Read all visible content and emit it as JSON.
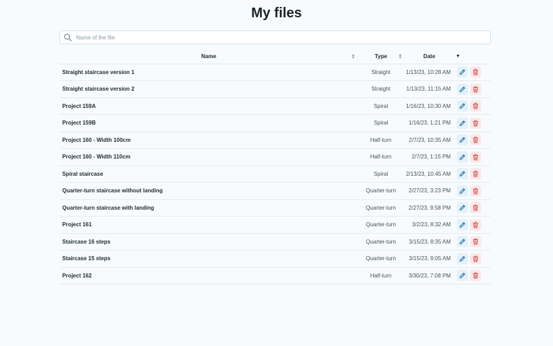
{
  "page": {
    "title": "My files"
  },
  "search": {
    "placeholder": "Name of the file",
    "value": ""
  },
  "columns": {
    "name": "Name",
    "type": "Type",
    "date": "Date"
  },
  "colors": {
    "edit_icon": "#1c6fa0",
    "delete_icon": "#d64545"
  },
  "files": [
    {
      "name": "Straight staircase version 1",
      "type": "Straight",
      "date": "1/13/23, 10:28 AM"
    },
    {
      "name": "Straight staircase version 2",
      "type": "Straight",
      "date": "1/13/23, 11:15 AM"
    },
    {
      "name": "Project 159A",
      "type": "Spiral",
      "date": "1/16/23, 10:30 AM"
    },
    {
      "name": "Project 159B",
      "type": "Spiral",
      "date": "1/16/23, 1:21 PM"
    },
    {
      "name": "Project 160 - Width 100cm",
      "type": "Half-turn",
      "date": "2/7/23, 10:35 AM"
    },
    {
      "name": "Project 160 - Width 110cm",
      "type": "Half-turn",
      "date": "2/7/23, 1:15 PM"
    },
    {
      "name": "Spiral staircase",
      "type": "Spiral",
      "date": "2/13/23, 10:45 AM"
    },
    {
      "name": "Quarter-turn staircase without landing",
      "type": "Quarter-turn",
      "date": "2/27/23, 3:23 PM"
    },
    {
      "name": "Quarter-turn staircase with landing",
      "type": "Quarter-turn",
      "date": "2/27/23, 9:58 PM"
    },
    {
      "name": "Project 161",
      "type": "Quarter-turn",
      "date": "3/2/23, 8:32 AM"
    },
    {
      "name": "Staircase 16 steps",
      "type": "Quarter-turn",
      "date": "3/15/23, 8:35 AM"
    },
    {
      "name": "Staircase 15 steps",
      "type": "Quarter-turn",
      "date": "3/15/23, 9:05 AM"
    },
    {
      "name": "Project 162",
      "type": "Half-turn",
      "date": "3/30/23, 7:08 PM"
    }
  ]
}
